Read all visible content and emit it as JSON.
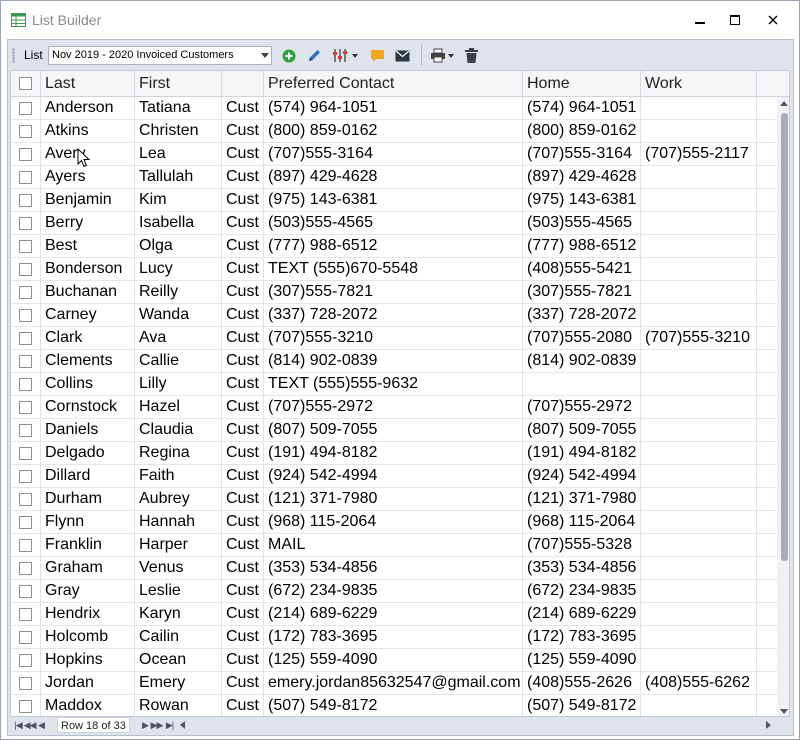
{
  "window": {
    "title": "List Builder"
  },
  "window_controls": {
    "minimize": "—",
    "maximize": "☐",
    "close": "✕"
  },
  "toolbar": {
    "list_label": "List",
    "list_selected": "Nov 2019 - 2020 Invoiced Customers",
    "buttons": [
      "add-icon",
      "edit-icon",
      "filter-icon",
      "comment-icon",
      "email-icon",
      "print-icon",
      "delete-icon"
    ]
  },
  "grid": {
    "columns": [
      "",
      "Last",
      "First",
      "",
      "Preferred Contact",
      "Home",
      "Work"
    ],
    "rows": [
      [
        "Anderson",
        "Tatiana",
        "Cust",
        "(574) 964-1051",
        "(574) 964-1051",
        ""
      ],
      [
        "Atkins",
        "Christen",
        "Cust",
        "(800) 859-0162",
        "(800) 859-0162",
        ""
      ],
      [
        "Avery",
        "Lea",
        "Cust",
        "(707)555-3164",
        "(707)555-3164",
        "(707)555-2117"
      ],
      [
        "Ayers",
        "Tallulah",
        "Cust",
        "(897) 429-4628",
        "(897) 429-4628",
        ""
      ],
      [
        "Benjamin",
        "Kim",
        "Cust",
        "(975) 143-6381",
        "(975) 143-6381",
        ""
      ],
      [
        "Berry",
        "Isabella",
        "Cust",
        "(503)555-4565",
        "(503)555-4565",
        ""
      ],
      [
        "Best",
        "Olga",
        "Cust",
        "(777) 988-6512",
        "(777) 988-6512",
        ""
      ],
      [
        "Bonderson",
        "Lucy",
        "Cust",
        "TEXT (555)670-5548",
        "(408)555-5421",
        ""
      ],
      [
        "Buchanan",
        "Reilly",
        "Cust",
        "(307)555-7821",
        "(307)555-7821",
        ""
      ],
      [
        "Carney",
        "Wanda",
        "Cust",
        "(337) 728-2072",
        "(337) 728-2072",
        ""
      ],
      [
        "Clark",
        "Ava",
        "Cust",
        "(707)555-3210",
        "(707)555-2080",
        "(707)555-3210"
      ],
      [
        "Clements",
        "Callie",
        "Cust",
        "(814) 902-0839",
        "(814) 902-0839",
        ""
      ],
      [
        "Collins",
        "Lilly",
        "Cust",
        "TEXT (555)555-9632",
        "",
        ""
      ],
      [
        "Cornstock",
        "Hazel",
        "Cust",
        "(707)555-2972",
        "(707)555-2972",
        ""
      ],
      [
        "Daniels",
        "Claudia",
        "Cust",
        "(807) 509-7055",
        "(807) 509-7055",
        ""
      ],
      [
        "Delgado",
        "Regina",
        "Cust",
        "(191) 494-8182",
        "(191) 494-8182",
        ""
      ],
      [
        "Dillard",
        "Faith",
        "Cust",
        "(924) 542-4994",
        "(924) 542-4994",
        ""
      ],
      [
        "Durham",
        "Aubrey",
        "Cust",
        "(121) 371-7980",
        "(121) 371-7980",
        ""
      ],
      [
        "Flynn",
        "Hannah",
        "Cust",
        "(968) 115-2064",
        "(968) 115-2064",
        ""
      ],
      [
        "Franklin",
        "Harper",
        "Cust",
        "MAIL",
        "(707)555-5328",
        ""
      ],
      [
        "Graham",
        "Venus",
        "Cust",
        "(353) 534-4856",
        "(353) 534-4856",
        ""
      ],
      [
        "Gray",
        "Leslie",
        "Cust",
        "(672) 234-9835",
        "(672) 234-9835",
        ""
      ],
      [
        "Hendrix",
        "Karyn",
        "Cust",
        "(214) 689-6229",
        "(214) 689-6229",
        ""
      ],
      [
        "Holcomb",
        "Cailin",
        "Cust",
        "(172) 783-3695",
        "(172) 783-3695",
        ""
      ],
      [
        "Hopkins",
        "Ocean",
        "Cust",
        "(125) 559-4090",
        "(125) 559-4090",
        ""
      ],
      [
        "Jordan",
        "Emery",
        "Cust",
        "emery.jordan85632547@gmail.com",
        "(408)555-2626",
        "(408)555-6262"
      ],
      [
        "Maddox",
        "Rowan",
        "Cust",
        "(507) 549-8172",
        "(507) 549-8172",
        ""
      ]
    ]
  },
  "navigator": {
    "status": "Row 18 of 33"
  },
  "colors": {
    "frame": "#dfe3ec",
    "grid_line": "#e4e6ea",
    "header_bg": "#f5f6f8",
    "add_green": "#2e9e3e",
    "edit_blue": "#2f6fc4",
    "comment_orange": "#f2a51e"
  }
}
